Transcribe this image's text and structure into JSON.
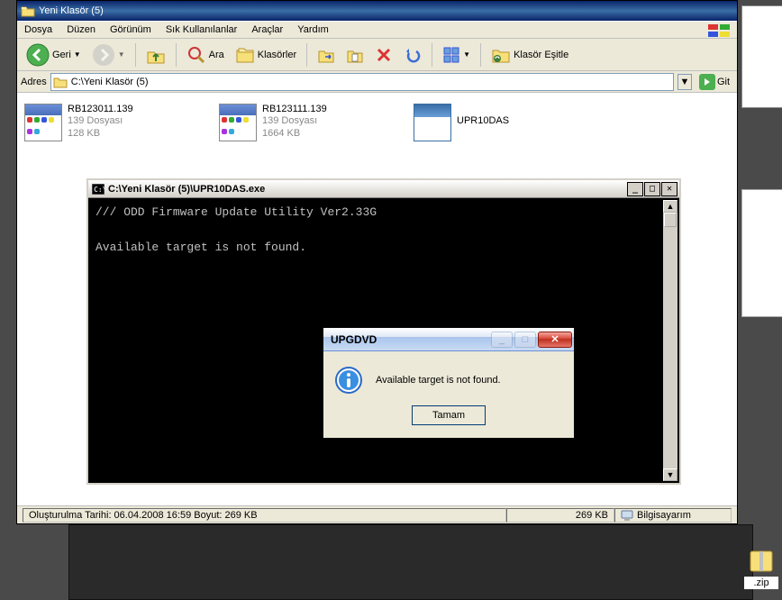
{
  "window": {
    "title": "Yeni Klasör (5)"
  },
  "menu": {
    "file": "Dosya",
    "edit": "Düzen",
    "view": "Görünüm",
    "favorites": "Sık Kullanılanlar",
    "tools": "Araçlar",
    "help": "Yardım"
  },
  "toolbar": {
    "back": "Geri",
    "search": "Ara",
    "folders": "Klasörler",
    "sync": "Klasör Eşitle"
  },
  "address": {
    "label": "Adres",
    "path": "C:\\Yeni Klasör (5)",
    "go": "Git"
  },
  "files": [
    {
      "name": "RB123011.139",
      "line2": "139 Dosyası",
      "line3": "128 KB",
      "type": "data"
    },
    {
      "name": "RB123111.139",
      "line2": "139 Dosyası",
      "line3": "1664 KB",
      "type": "data"
    },
    {
      "name": "UPR10DAS",
      "line2": "",
      "line3": "",
      "type": "exe"
    }
  ],
  "status": {
    "left": "Oluşturulma Tarihi: 06.04.2008 16:59 Boyut: 269 KB",
    "size": "269 KB",
    "location": "Bilgisayarım"
  },
  "console": {
    "title": "C:\\Yeni Klasör (5)\\UPR10DAS.exe",
    "line1": "/// ODD Firmware Update Utility Ver2.33G",
    "line2": "Available target is not found."
  },
  "dialog": {
    "title": "UPGDVD",
    "message": "Available target is not found.",
    "ok": "Tamam"
  },
  "bg": {
    "zip_label": ".zip"
  }
}
